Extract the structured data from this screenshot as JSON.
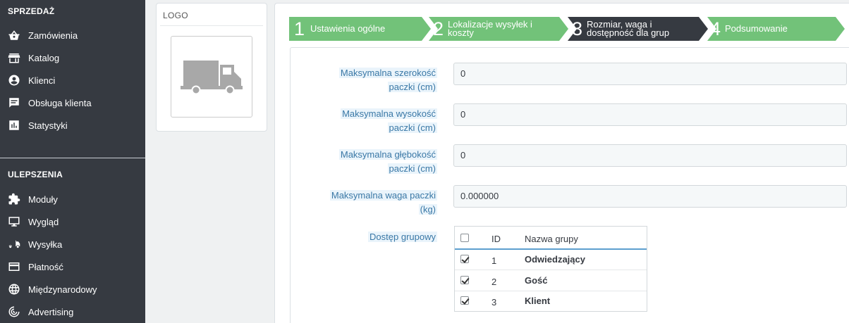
{
  "sidebar": {
    "section_sell": "SPRZEDAŻ",
    "section_improve": "ULEPSZENIA",
    "sell_items": [
      {
        "label": "Zamówienia",
        "icon": "shopping-basket-icon"
      },
      {
        "label": "Katalog",
        "icon": "store-icon"
      },
      {
        "label": "Klienci",
        "icon": "account-circle-icon"
      },
      {
        "label": "Obsługa klienta",
        "icon": "chat-icon"
      },
      {
        "label": "Statystyki",
        "icon": "bar-chart-icon"
      }
    ],
    "improve_items": [
      {
        "label": "Moduły",
        "icon": "puzzle-icon"
      },
      {
        "label": "Wygląd",
        "icon": "desktop-icon"
      },
      {
        "label": "Wysyłka",
        "icon": "truck-icon"
      },
      {
        "label": "Płatność",
        "icon": "credit-card-icon"
      },
      {
        "label": "Międzynarodowy",
        "icon": "globe-icon"
      },
      {
        "label": "Advertising",
        "icon": "advertising-icon"
      }
    ]
  },
  "logo_card": {
    "title": "LOGO",
    "image_icon": "truck-placeholder-icon"
  },
  "wizard": {
    "steps": [
      {
        "number": "1",
        "line1": "Ustawienia ogólne",
        "line2": "",
        "state": "done"
      },
      {
        "number": "2",
        "line1": "Lokalizacje wysyłek i",
        "line2": "koszty",
        "state": "done"
      },
      {
        "number": "3",
        "line1": "Rozmiar, waga i",
        "line2": "dostępność dla grup",
        "state": "current"
      },
      {
        "number": "4",
        "line1": "Podsumowanie",
        "line2": "",
        "state": "done"
      }
    ],
    "colors": {
      "done": "#72c279",
      "current": "#363a41"
    }
  },
  "form": {
    "fields": [
      {
        "label_line1": "Maksymalna szerokość",
        "label_line2": "paczki (cm)",
        "value": "0"
      },
      {
        "label_line1": "Maksymalna wysokość",
        "label_line2": "paczki (cm)",
        "value": "0"
      },
      {
        "label_line1": "Maksymalna głębokość",
        "label_line2": "paczki (cm)",
        "value": "0"
      },
      {
        "label_line1": "Maksymalna waga paczki",
        "label_line2": "(kg)",
        "value": "0.000000"
      }
    ],
    "group_access": {
      "label": "Dostęp grupowy",
      "header_id": "ID",
      "header_name": "Nazwa grupy",
      "rows": [
        {
          "id": "1",
          "name": "Odwiedzający",
          "checked": true
        },
        {
          "id": "2",
          "name": "Gość",
          "checked": true
        },
        {
          "id": "3",
          "name": "Klient",
          "checked": true
        }
      ]
    }
  }
}
